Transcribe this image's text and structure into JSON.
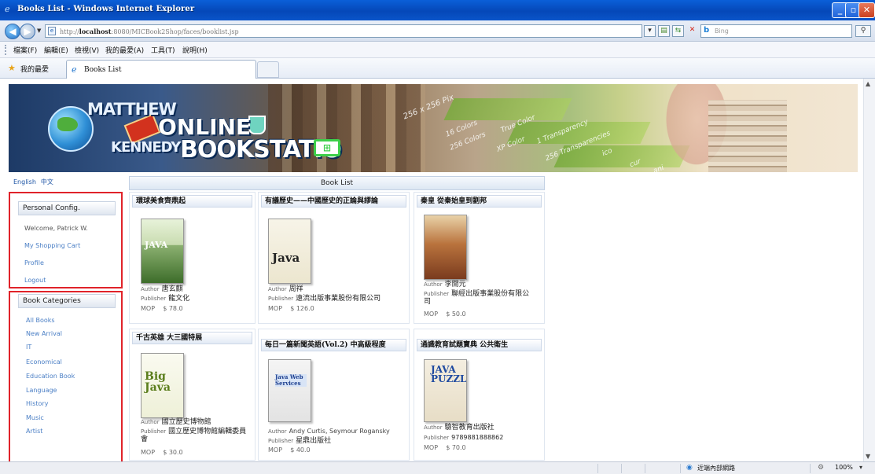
{
  "window": {
    "title": "Books List - Windows Internet Explorer",
    "min_label": "_",
    "max_label": "▫",
    "close_label": "✕"
  },
  "address": {
    "url_prefix": "http://",
    "url_host": "localhost",
    "url_rest": ":8080/MICBook2Shop/faces/booklist.jsp",
    "search_engine": "Bing"
  },
  "menu": [
    "檔案(F)",
    "編輯(E)",
    "檢視(V)",
    "我的最愛(A)",
    "工具(T)",
    "說明(H)"
  ],
  "favorites": {
    "label": "我的最愛",
    "tab_title": "Books List"
  },
  "banner": {
    "line1": "MATTHEW",
    "online": "ONLINE",
    "line2": "KENNEDY",
    "bookstation": "BOOKSTATIO",
    "texts": [
      "256 x 256 Pix",
      "16 Colors",
      "256 Colors",
      "True Color",
      "XP Color",
      "1 Transparency",
      "256 Transparencies",
      "ico",
      "cur",
      "ani"
    ]
  },
  "language": {
    "english": "English",
    "chinese": "中文"
  },
  "personal": {
    "title": "Personal Config.",
    "welcome": "Welcome, Patrick W.",
    "links": [
      "My Shopping Cart",
      "Profile",
      "Logout"
    ]
  },
  "categories": {
    "title": "Book Categories",
    "items": [
      "All Books",
      "New Arrival",
      "IT",
      "Economical",
      "Education Book",
      "Language",
      "History",
      "Music",
      "Artist"
    ]
  },
  "book_list": {
    "title": "Book List",
    "author_label": "Author",
    "publisher_label": "Publisher",
    "mop_label": "MOP",
    "books": [
      {
        "title": "環球美食齊鼎起",
        "cover": "JAVA",
        "author": "唐玄麒",
        "publisher": "龍文化",
        "price": "$ 78.0"
      },
      {
        "title": "有議歷史——中國歷史的正論與謬論",
        "cover": "Java",
        "author": "周祥",
        "publisher": "遠流出版事業股份有限公司",
        "price": "$ 126.0"
      },
      {
        "title": "秦皇 從秦始皇到劉邦",
        "cover": "",
        "author": "李開元",
        "publisher": "聯經出版事業股份有限公司",
        "price": "$ 50.0"
      },
      {
        "title": "千古英雄 大三國特展",
        "cover": "Big Java",
        "author": "國立歷史博物館",
        "publisher": "國立歷史博物館編輯委員會",
        "price": "$ 30.0"
      },
      {
        "title": "每日一篇新聞英語(Vol.2) 中高級程度",
        "cover": "Java Web Services",
        "author": "Andy Curtis, Seymour Rogansky",
        "publisher": "星鼎出版社",
        "price": "$ 40.0"
      },
      {
        "title": "通識教育試題寶典 公共衛生",
        "cover": "JAVA PUZZLERS",
        "author": "驗智教育出版社",
        "publisher": "9789881888862",
        "price": "$ 70.0"
      }
    ]
  },
  "status": {
    "zone": "近端內部網路",
    "zoom": "100%"
  },
  "colors": {
    "highlight_border": "#e0232a",
    "link": "#4b7fc5",
    "titlebar": "#0548b8"
  }
}
